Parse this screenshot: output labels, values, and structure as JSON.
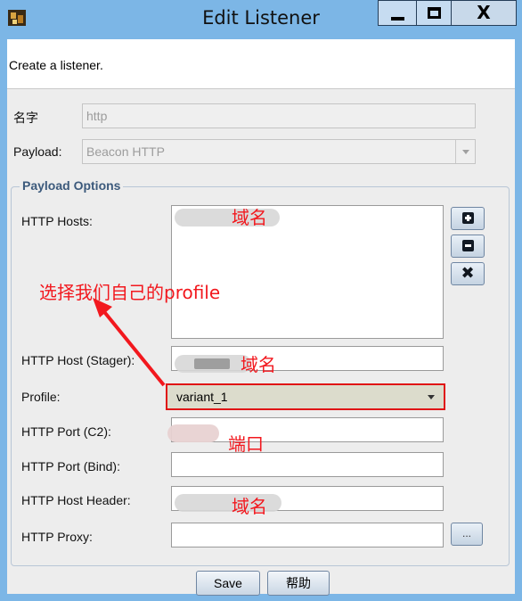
{
  "window": {
    "title": "Edit Listener",
    "minimize_glyph": "",
    "maximize_glyph": "",
    "close_glyph": "X",
    "icon": "app-icon"
  },
  "description": "Create a listener.",
  "fields": {
    "name_label": "名字",
    "name_value": "http",
    "payload_label": "Payload:",
    "payload_value": "Beacon HTTP"
  },
  "payload_options": {
    "title": "Payload Options",
    "http_hosts_label": "HTTP Hosts:",
    "http_host_stager_label": "HTTP Host (Stager):",
    "profile_label": "Profile:",
    "profile_value": "variant_1",
    "http_port_c2_label": "HTTP Port (C2):",
    "http_port_bind_label": "HTTP Port (Bind):",
    "http_host_header_label": "HTTP Host Header:",
    "http_proxy_label": "HTTP Proxy:",
    "proxy_button_label": "...",
    "add_icon": "plus-square-icon",
    "remove_icon": "minus-square-icon",
    "clear_icon": "x-icon",
    "clear_glyph": "✖"
  },
  "buttons": {
    "save": "Save",
    "help": "帮助"
  },
  "annotations": {
    "hosts_note": "域名",
    "select_note": "选择我们自己的profile",
    "stager_note": "域名",
    "port_note": "端口",
    "header_note": "域名",
    "color": "#f2181e"
  }
}
